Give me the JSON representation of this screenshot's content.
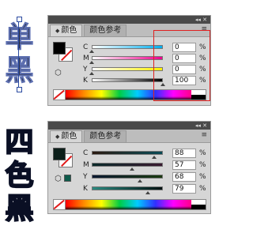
{
  "labels": {
    "top": [
      "单",
      "黑"
    ],
    "bottom": [
      "四",
      "色",
      "黑"
    ]
  },
  "panel_common": {
    "tab_color": "颜色",
    "tab_guide": "颜色参考",
    "window_controls": "◂◂ ✕",
    "menu_icon": "≡",
    "percent": "%"
  },
  "panel_top": {
    "fill_color": "#000000",
    "rows": [
      {
        "label": "C",
        "value": "0",
        "level": 0,
        "gradient": "#ffffff,#00aeef"
      },
      {
        "label": "M",
        "value": "0",
        "level": 0,
        "gradient": "#ffffff,#ec008c"
      },
      {
        "label": "Y",
        "value": "0",
        "level": 0,
        "gradient": "#ffffff,#fff200"
      },
      {
        "label": "K",
        "value": "100",
        "level": 100,
        "gradient": "#ffffff,#000000"
      }
    ]
  },
  "panel_bottom": {
    "fill_color": "#0c1f1a",
    "gamut_color": "#0c5a4a",
    "rows": [
      {
        "label": "C",
        "value": "88",
        "level": 88,
        "gradient": "#2a1a10,#0a4a55"
      },
      {
        "label": "M",
        "value": "57",
        "level": 57,
        "gradient": "#0a2a2a,#3a1a30"
      },
      {
        "label": "Y",
        "value": "68",
        "level": 68,
        "gradient": "#0a1830,#1a3a10"
      },
      {
        "label": "K",
        "value": "79",
        "level": 79,
        "gradient": "#2a8a80,#001010"
      }
    ]
  },
  "colors": {
    "highlight": "#e02020",
    "label_blue": "#2a4aa0"
  }
}
